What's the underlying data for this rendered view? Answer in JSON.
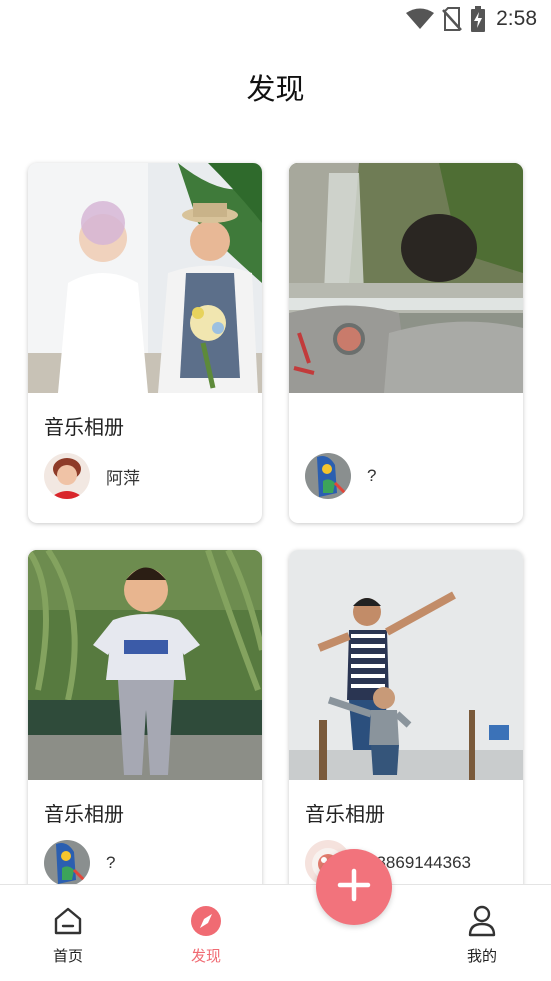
{
  "status_bar": {
    "time": "2:58",
    "icons": [
      "wifi-icon",
      "no-sim-icon",
      "battery-charging-icon"
    ]
  },
  "header": {
    "title": "发现"
  },
  "albums": [
    {
      "caption": "音乐相册",
      "owner": "阿萍",
      "photo": "wedding-couple-photo",
      "avatar": "woman-avatar"
    },
    {
      "caption": "",
      "owner": "?",
      "photo": "waterfall-cave-photo",
      "avatar": "peacock-avatar"
    },
    {
      "caption": "音乐相册",
      "owner": "?",
      "photo": "boy-by-lake-photo",
      "avatar": "peacock-avatar"
    },
    {
      "caption": "音乐相册",
      "owner": "13869144363",
      "photo": "father-son-dab-photo",
      "avatar": "cake-avatar"
    }
  ],
  "nav": {
    "items": [
      {
        "label": "首页",
        "icon": "home-icon",
        "active": false
      },
      {
        "label": "发现",
        "icon": "compass-icon",
        "active": true
      },
      {
        "label": "我的",
        "icon": "user-icon",
        "active": false
      }
    ],
    "fab_icon": "plus-icon"
  },
  "colors": {
    "accent": "#f06b73",
    "fab": "#f2737c"
  }
}
